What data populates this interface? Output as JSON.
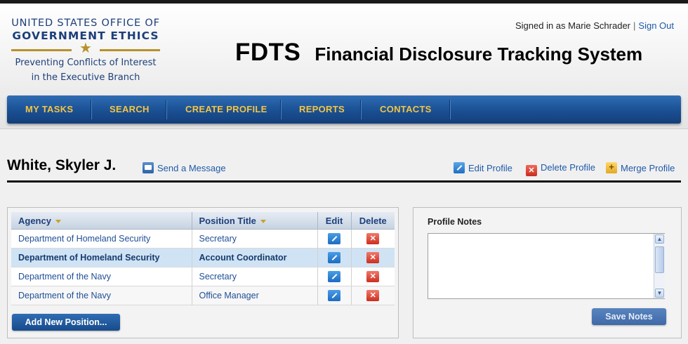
{
  "logo": {
    "line1": "UNITED STATES OFFICE OF",
    "line2": "GOVERNMENT ETHICS",
    "tagline1": "Preventing Conflicts of Interest",
    "tagline2": "in the Executive Branch"
  },
  "header": {
    "signed_in_text": "Signed in as Marie Schrader",
    "separator": "|",
    "sign_out": "Sign Out",
    "app_abbr": "FDTS",
    "app_title": "Financial Disclosure Tracking System"
  },
  "nav": {
    "items": [
      {
        "label": "MY TASKS"
      },
      {
        "label": "SEARCH"
      },
      {
        "label": "CREATE PROFILE"
      },
      {
        "label": "REPORTS"
      },
      {
        "label": "CONTACTS"
      }
    ]
  },
  "profile": {
    "name": "White, Skyler J.",
    "send_message": "Send a Message",
    "edit_profile": "Edit Profile",
    "delete_profile": "Delete Profile",
    "merge_profile": "Merge Profile"
  },
  "positions": {
    "columns": [
      "Agency",
      "Position Title",
      "Edit",
      "Delete"
    ],
    "rows": [
      {
        "agency": "Department of Homeland Security",
        "title": "Secretary",
        "selected": false
      },
      {
        "agency": "Department of Homeland Security",
        "title": "Account Coordinator",
        "selected": true
      },
      {
        "agency": "Department of the Navy",
        "title": "Secretary",
        "selected": false
      },
      {
        "agency": "Department of the Navy",
        "title": "Office Manager",
        "selected": false
      }
    ],
    "add_button": "Add New Position..."
  },
  "notes": {
    "title": "Profile Notes",
    "value": "",
    "save_button": "Save Notes"
  },
  "colors": {
    "nav_blue": "#1a4f93",
    "nav_text": "#f4c542",
    "link_blue": "#1f5aa8",
    "selected_row": "#cfe3f5"
  }
}
